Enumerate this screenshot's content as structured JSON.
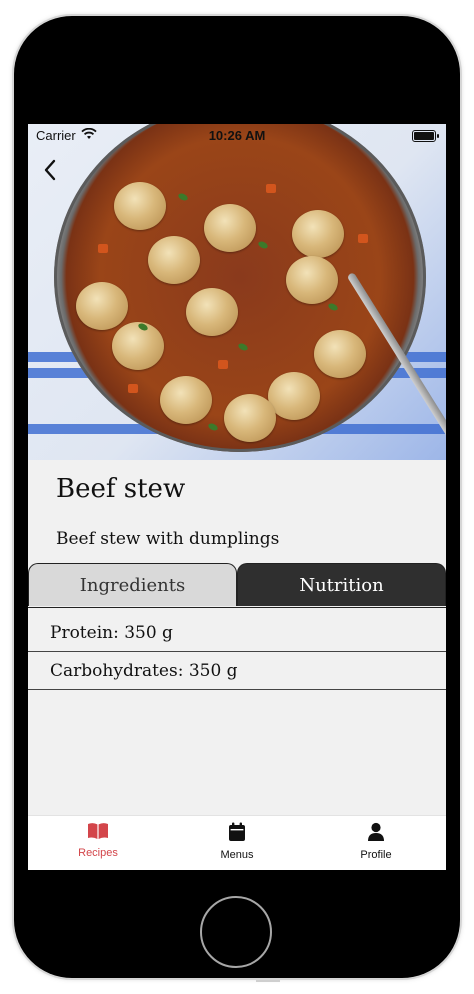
{
  "status_bar": {
    "carrier": "Carrier",
    "time": "10:26 AM"
  },
  "recipe": {
    "title": "Beef stew",
    "description": "Beef stew with dumplings"
  },
  "tabs": [
    {
      "label": "Ingredients",
      "selected": false
    },
    {
      "label": "Nutrition",
      "selected": true
    }
  ],
  "nutrition": [
    {
      "text": "Protein: 350 g"
    },
    {
      "text": "Carbohydrates: 350 g"
    }
  ],
  "tabbar": {
    "items": [
      {
        "label": "Recipes",
        "icon": "book-icon",
        "active": true
      },
      {
        "label": "Menus",
        "icon": "calendar-icon",
        "active": false
      },
      {
        "label": "Profile",
        "icon": "person-icon",
        "active": false
      }
    ]
  },
  "colors": {
    "accent": "#d3454a",
    "tab_selected_bg": "#2f2f2f",
    "tab_unselected_bg": "#d9d9d9",
    "screen_bg": "#f1f1f1"
  }
}
